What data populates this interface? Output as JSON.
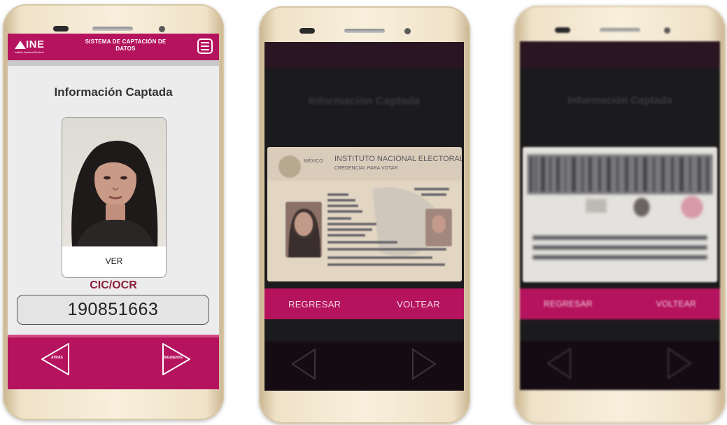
{
  "phone1": {
    "logo_text": "INE",
    "logo_subtitle": "Instituto Nacional Electoral",
    "appbar_title": "SISTEMA DE CAPTACIÓN DE DATOS",
    "page_title": "Información Captada",
    "ver_label": "VER",
    "cic_label": "CIC/OCR",
    "cic_value": "190851663",
    "back_label": "ATRÁS",
    "next_label": "SIGUIENTE",
    "accent_color": "#b5135e"
  },
  "phone2": {
    "background_title": "Información Captada",
    "card_header_country": "MÉXICO",
    "card_header_institute": "INSTITUTO NACIONAL ELECTORAL",
    "card_header_subtitle": "CREDENCIAL PARA VOTAR",
    "regresar_label": "REGRESAR",
    "voltear_label": "VOLTEAR"
  },
  "phone3": {
    "background_title": "Información Captada",
    "regresar_label": "REGRESAR",
    "voltear_label": "VOLTEAR"
  }
}
